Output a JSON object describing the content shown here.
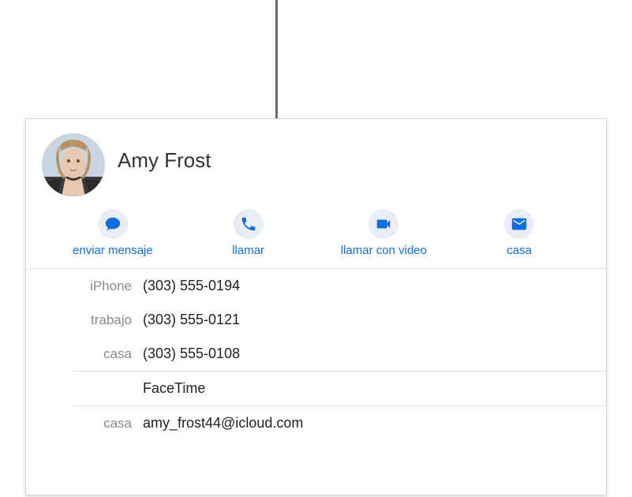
{
  "contact": {
    "name": "Amy Frost"
  },
  "actions": {
    "message": "enviar mensaje",
    "call": "llamar",
    "video": "llamar con video",
    "mail": "casa"
  },
  "phones": [
    {
      "label": "iPhone",
      "value": "(303) 555-0194"
    },
    {
      "label": "trabajo",
      "value": "(303) 555-0121"
    },
    {
      "label": "casa",
      "value": "(303) 555-0108"
    }
  ],
  "facetime": {
    "label": "",
    "value": "FaceTime"
  },
  "email": {
    "label": "casa",
    "value": "amy_frost44@icloud.com"
  }
}
